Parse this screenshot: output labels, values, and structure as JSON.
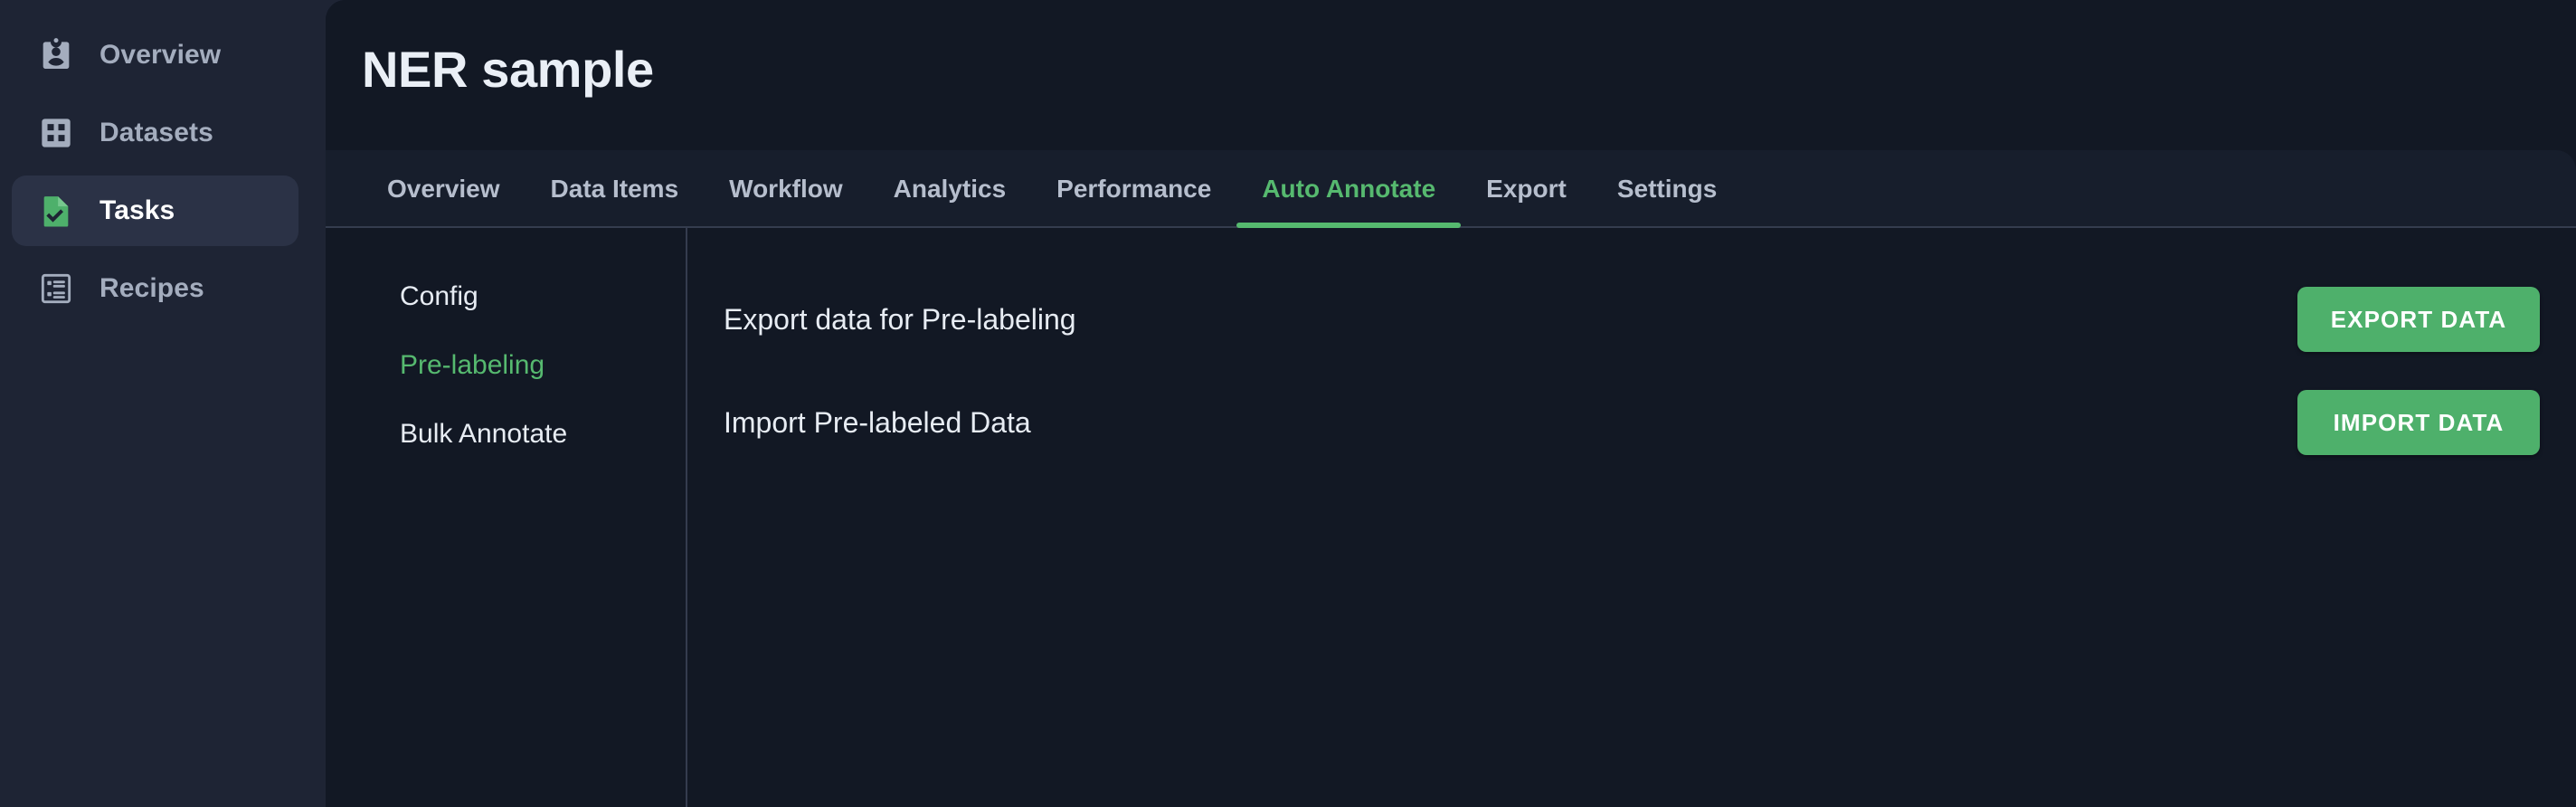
{
  "sidebar": {
    "items": [
      {
        "label": "Overview",
        "icon": "id-badge-icon",
        "active": false
      },
      {
        "label": "Datasets",
        "icon": "grid-icon",
        "active": false
      },
      {
        "label": "Tasks",
        "icon": "task-check-icon",
        "active": true
      },
      {
        "label": "Recipes",
        "icon": "list-icon",
        "active": false
      }
    ]
  },
  "header": {
    "title": "NER sample"
  },
  "tabs": [
    {
      "label": "Overview",
      "active": false
    },
    {
      "label": "Data Items",
      "active": false
    },
    {
      "label": "Workflow",
      "active": false
    },
    {
      "label": "Analytics",
      "active": false
    },
    {
      "label": "Performance",
      "active": false
    },
    {
      "label": "Auto Annotate",
      "active": true
    },
    {
      "label": "Export",
      "active": false
    },
    {
      "label": "Settings",
      "active": false
    }
  ],
  "subnav": {
    "items": [
      {
        "label": "Config",
        "active": false
      },
      {
        "label": "Pre-labeling",
        "active": true
      },
      {
        "label": "Bulk Annotate",
        "active": false
      }
    ]
  },
  "main": {
    "rows": [
      {
        "label": "Export data for Pre-labeling",
        "button": "EXPORT DATA"
      },
      {
        "label": "Import Pre-labeled Data",
        "button": "IMPORT DATA"
      }
    ]
  },
  "colors": {
    "accent_green": "#56b96f",
    "button_green": "#4eb06b",
    "sidebar_bg": "#1e2434",
    "panel_bg": "#121824",
    "tabbar_bg": "#171e2c",
    "divider": "#343c4e",
    "text_primary": "#e7ecf3",
    "text_muted": "#a4adbe"
  }
}
